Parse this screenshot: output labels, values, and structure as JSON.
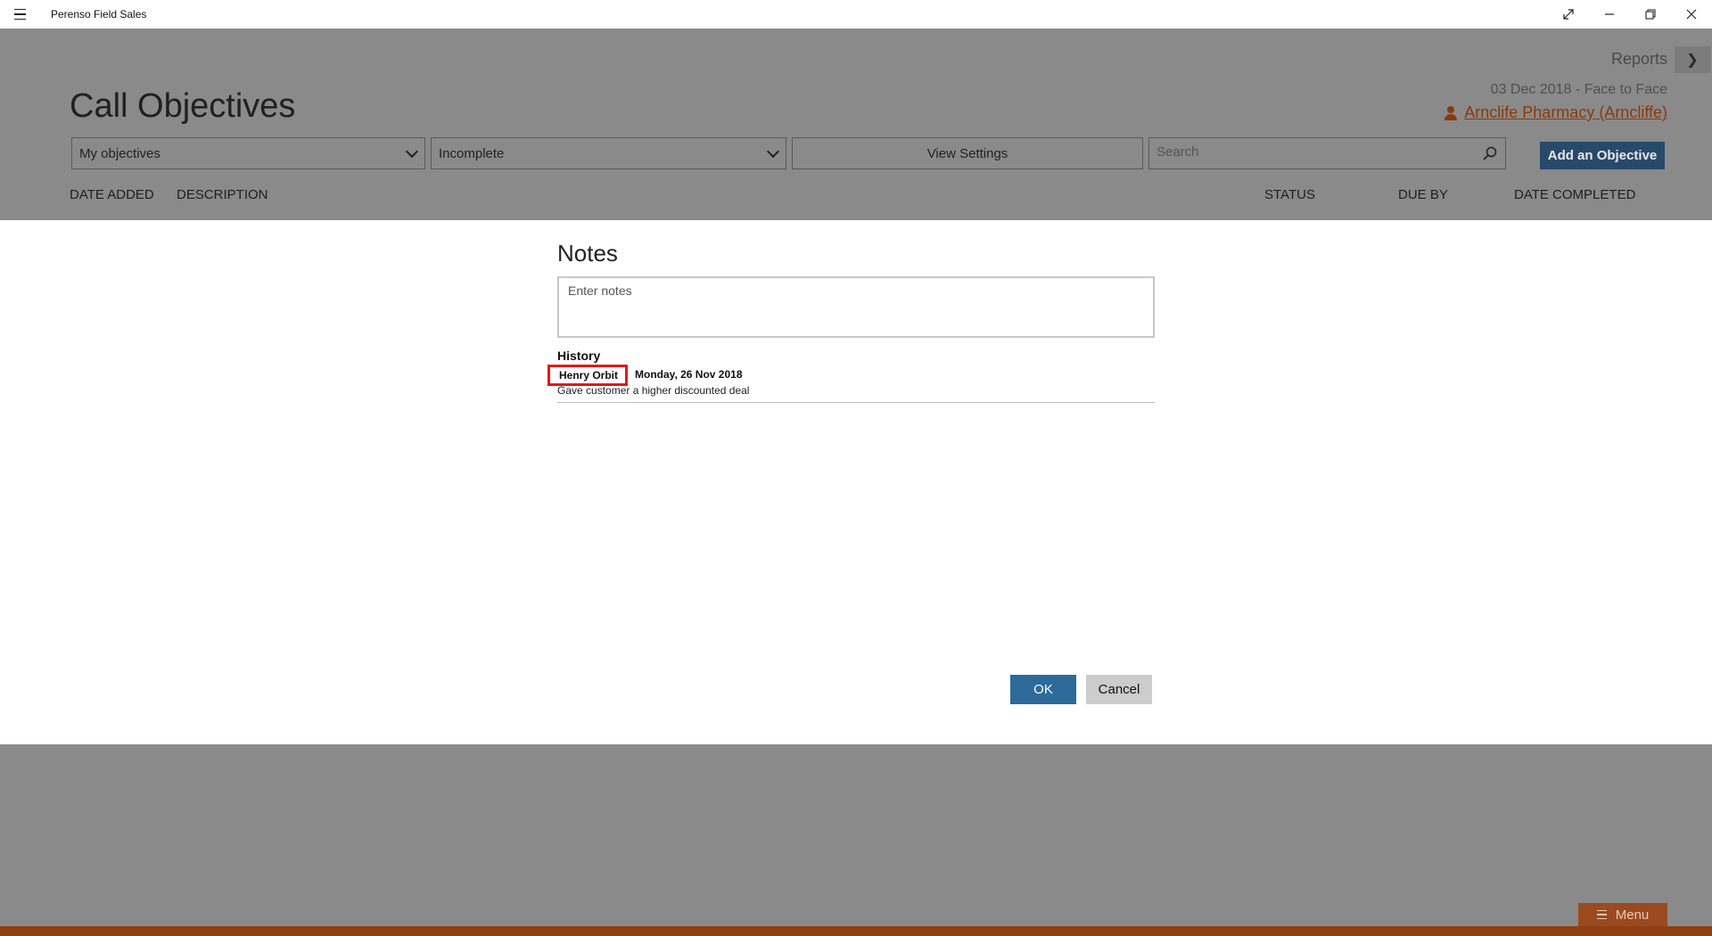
{
  "window": {
    "app_title": "Perenso Field Sales",
    "icons": [
      "menu-icon",
      "fullscreen-icon",
      "minimize-icon",
      "restore-icon",
      "close-icon"
    ]
  },
  "header": {
    "reports_label": "Reports",
    "call_meta": "03 Dec 2018  -  Face to Face",
    "customer_name": "Arnclife Pharmacy (Arncliffe)",
    "page_title": "Call Objectives"
  },
  "toolbar": {
    "scope_value": "My objectives",
    "status_value": "Incomplete",
    "view_settings_label": "View Settings",
    "search_placeholder": "Search",
    "add_objective_label": "Add an Objective"
  },
  "columns": {
    "date_added": "DATE ADDED",
    "description": "DESCRIPTION",
    "status": "STATUS",
    "due_by": "DUE BY",
    "date_completed": "DATE COMPLETED"
  },
  "notes_dialog": {
    "title": "Notes",
    "notes_placeholder": "Enter notes",
    "history_title": "History",
    "history": [
      {
        "author": "Henry Orbit",
        "date": "Monday, 26 Nov 2018",
        "text": "Gave customer a higher discounted deal"
      }
    ],
    "ok_label": "OK",
    "cancel_label": "Cancel"
  },
  "footer": {
    "menu_label": "Menu"
  },
  "colors": {
    "accent_blue": "#2d6a99",
    "add_button": "#274a6b",
    "brand_orange": "#8f3f12",
    "highlight_red": "#e01a1a",
    "overlay_gray": "#8a8a8a"
  }
}
